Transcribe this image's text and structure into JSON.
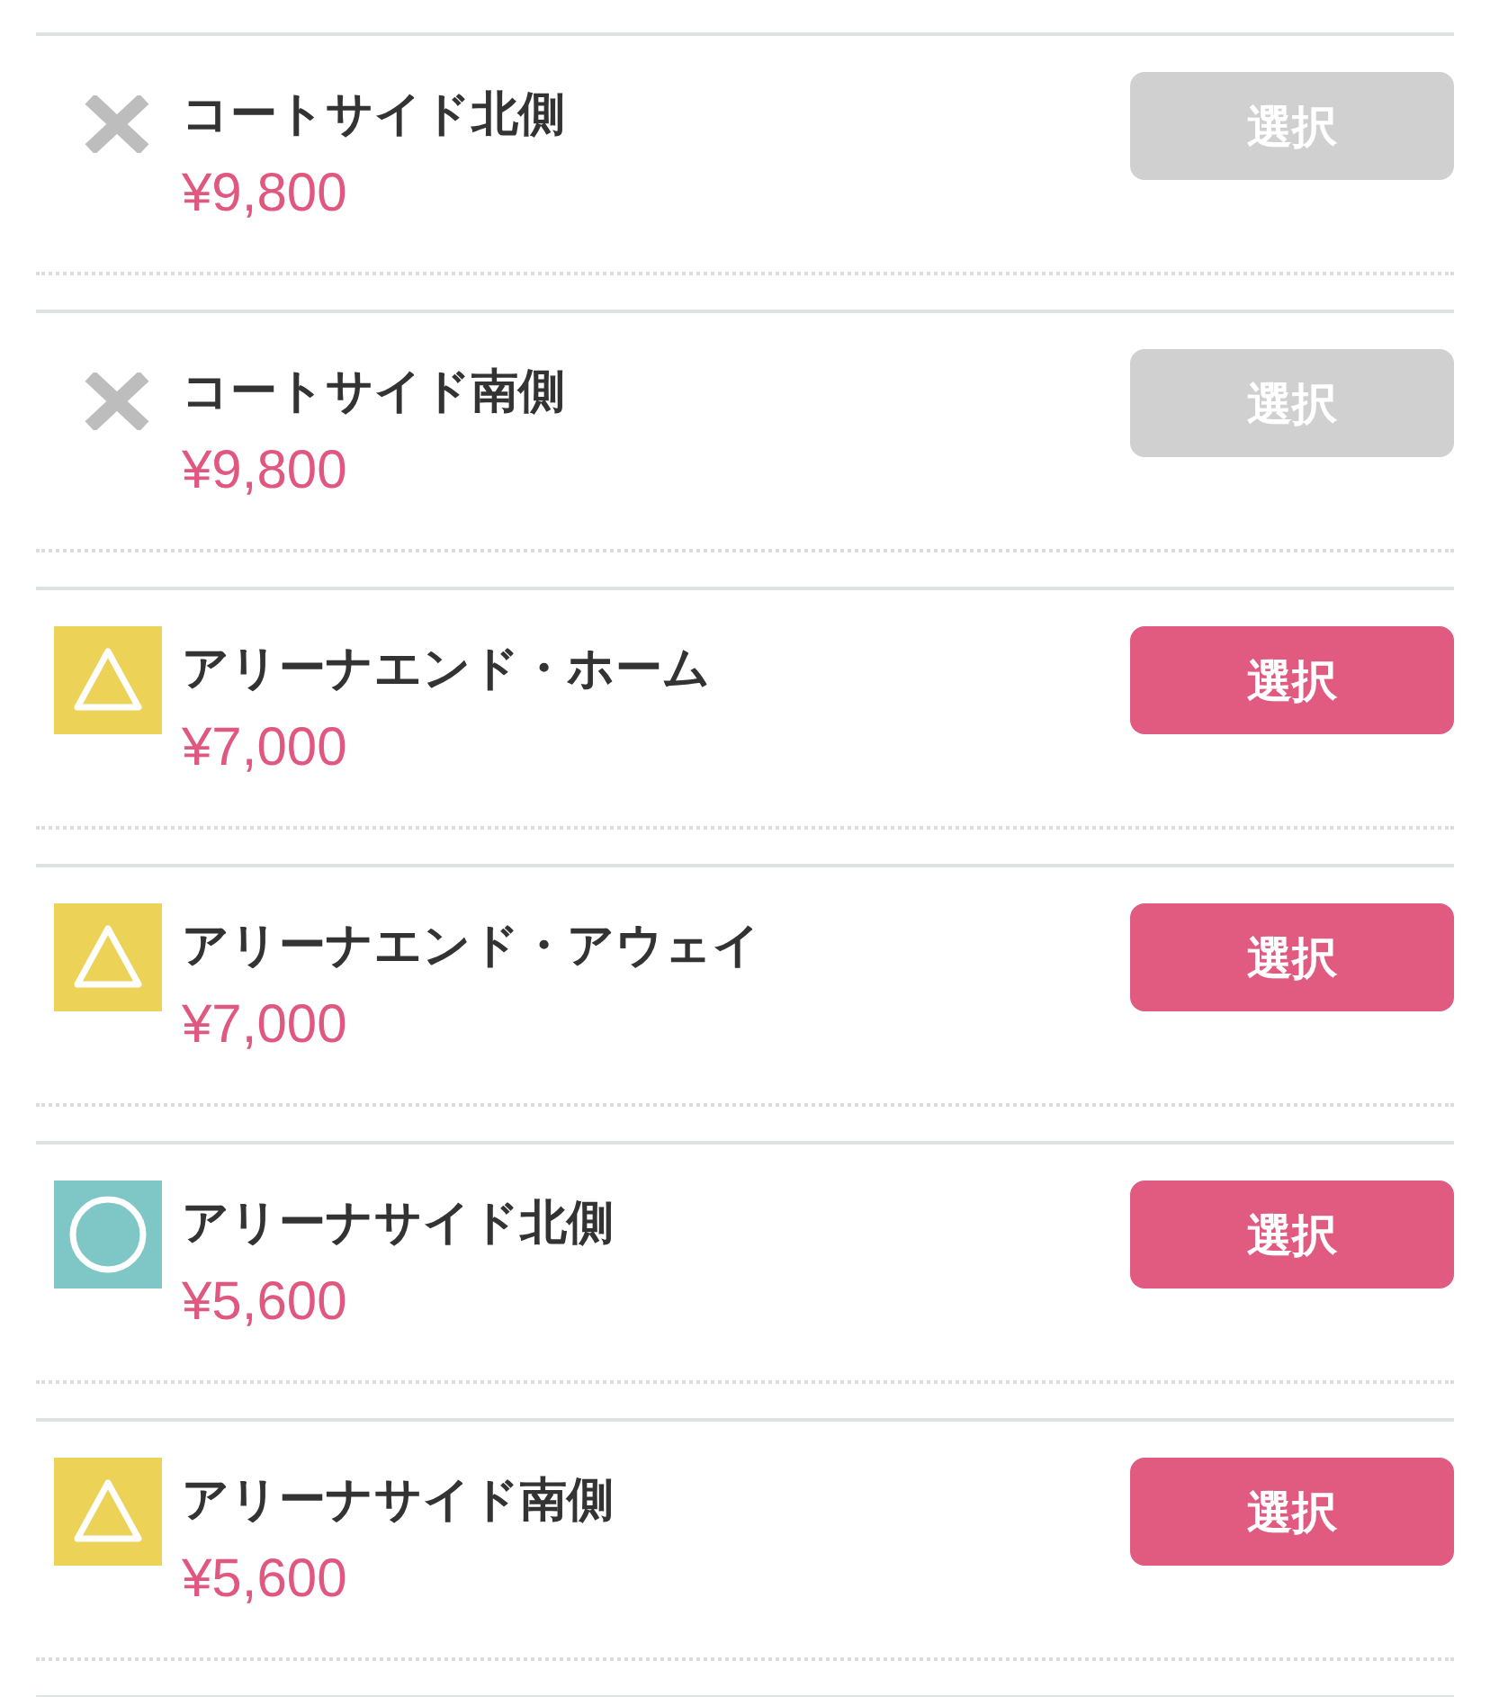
{
  "seats": [
    {
      "kind": "cross",
      "name": "コートサイド北側",
      "price": "¥9,800",
      "button": {
        "label": "選択",
        "disabled": true
      }
    },
    {
      "kind": "cross",
      "name": "コートサイド南側",
      "price": "¥9,800",
      "button": {
        "label": "選択",
        "disabled": true
      }
    },
    {
      "kind": "triangle",
      "name": "アリーナエンド・ホーム",
      "price": "¥7,000",
      "button": {
        "label": "選択",
        "disabled": false
      }
    },
    {
      "kind": "triangle",
      "name": "アリーナエンド・アウェイ",
      "price": "¥7,000",
      "button": {
        "label": "選択",
        "disabled": false
      }
    },
    {
      "kind": "circle",
      "name": "アリーナサイド北側",
      "price": "¥5,600",
      "button": {
        "label": "選択",
        "disabled": false
      }
    },
    {
      "kind": "triangle",
      "name": "アリーナサイド南側",
      "price": "¥5,600",
      "button": {
        "label": "選択",
        "disabled": false
      }
    }
  ]
}
